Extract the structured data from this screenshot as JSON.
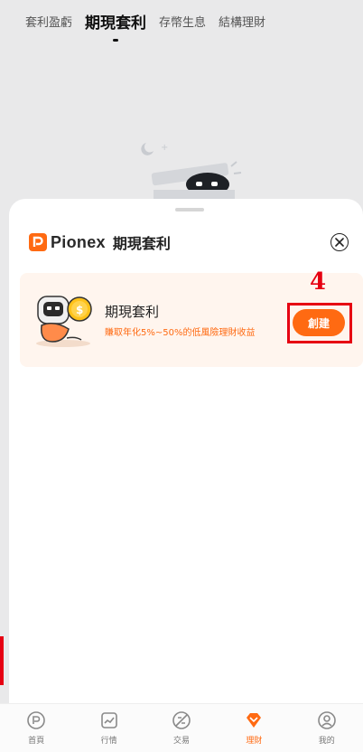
{
  "top_tabs": [
    {
      "label": "套利盈虧"
    },
    {
      "label": "期現套利"
    },
    {
      "label": "存幣生息"
    },
    {
      "label": "結構理財"
    }
  ],
  "sheet": {
    "brand": "Pionex",
    "title": "期現套利",
    "card": {
      "title": "期現套利",
      "description": "賺取年化5%~50%的低風險理財收益",
      "button_label": "創建"
    }
  },
  "annotation": {
    "step": "4"
  },
  "bottom_nav": [
    {
      "label": "首頁",
      "icon": "home-icon"
    },
    {
      "label": "行情",
      "icon": "market-chart-icon"
    },
    {
      "label": "交易",
      "icon": "trade-icon"
    },
    {
      "label": "理財",
      "icon": "diamond-icon",
      "active": true
    },
    {
      "label": "我的",
      "icon": "profile-icon"
    }
  ],
  "colors": {
    "accent": "#ff6a12",
    "annotation": "#e60012"
  }
}
